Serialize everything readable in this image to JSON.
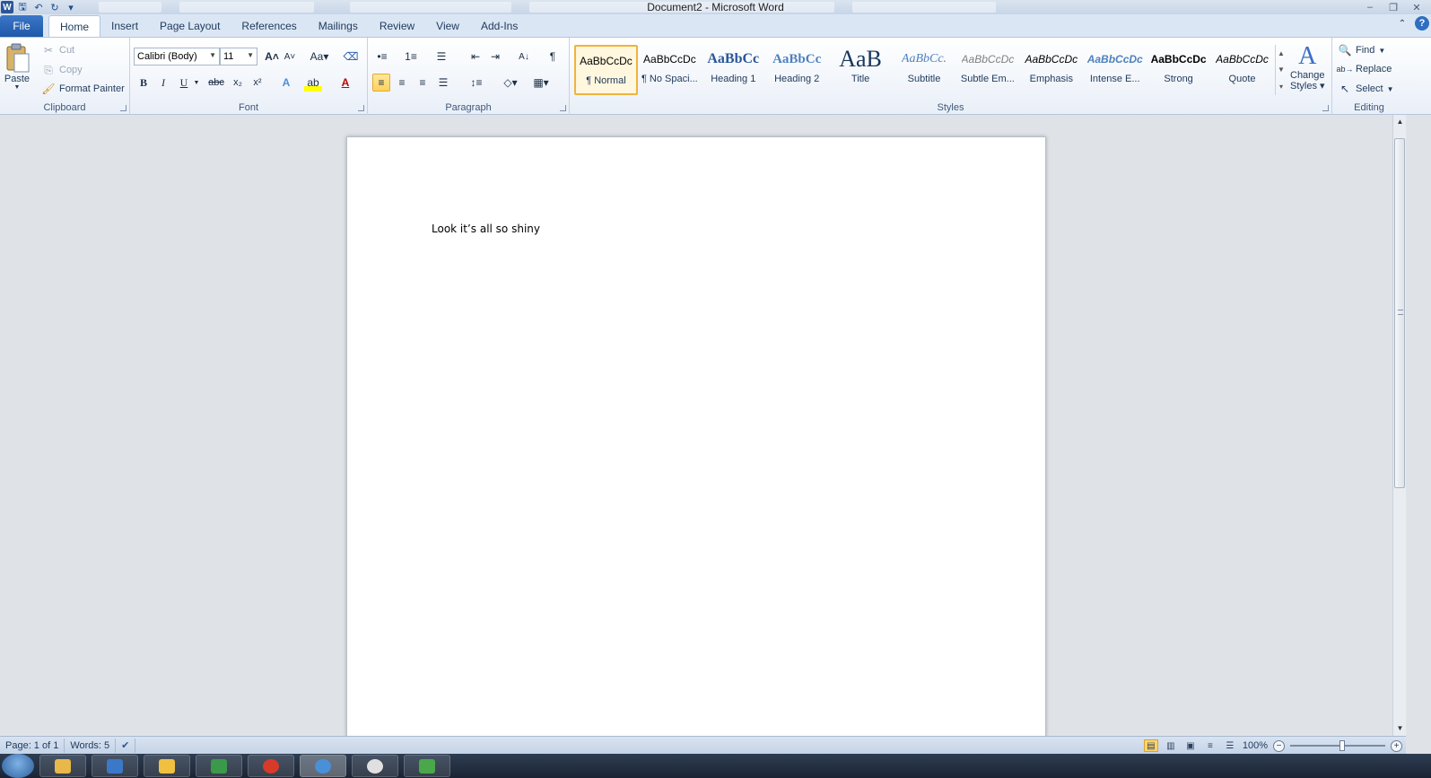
{
  "window": {
    "title": "Document2 - Microsoft Word",
    "qat_icons": [
      "word-logo-icon",
      "save-icon",
      "undo-icon",
      "redo-icon",
      "customize-qat-icon"
    ]
  },
  "tabs": {
    "file": "File",
    "items": [
      "Home",
      "Insert",
      "Page Layout",
      "References",
      "Mailings",
      "Review",
      "View",
      "Add-Ins"
    ],
    "active": "Home"
  },
  "clipboard": {
    "group_label": "Clipboard",
    "paste": "Paste",
    "cut": "Cut",
    "copy": "Copy",
    "format_painter": "Format Painter"
  },
  "font": {
    "group_label": "Font",
    "font_name": "Calibri (Body)",
    "font_size": "11"
  },
  "paragraph": {
    "group_label": "Paragraph"
  },
  "styles": {
    "group_label": "Styles",
    "items": [
      {
        "sample": "AaBbCcDc",
        "name": "¶ Normal"
      },
      {
        "sample": "AaBbCcDc",
        "name": "¶ No Spaci..."
      },
      {
        "sample": "AaBbCc",
        "name": "Heading 1"
      },
      {
        "sample": "AaBbCc",
        "name": "Heading 2"
      },
      {
        "sample": "AaB",
        "name": "Title"
      },
      {
        "sample": "AaBbCc.",
        "name": "Subtitle"
      },
      {
        "sample": "AaBbCcDc",
        "name": "Subtle Em..."
      },
      {
        "sample": "AaBbCcDc",
        "name": "Emphasis"
      },
      {
        "sample": "AaBbCcDc",
        "name": "Intense E..."
      },
      {
        "sample": "AaBbCcDc",
        "name": "Strong"
      },
      {
        "sample": "AaBbCcDc",
        "name": "Quote"
      }
    ],
    "change_styles_line1": "Change",
    "change_styles_line2": "Styles"
  },
  "editing": {
    "group_label": "Editing",
    "find": "Find",
    "replace": "Replace",
    "select": "Select"
  },
  "document": {
    "text": "Look it’s all so shiny"
  },
  "statusbar": {
    "page": "Page: 1 of 1",
    "words": "Words: 5",
    "zoom": "100%"
  },
  "colors": {
    "accent": "#2a5699",
    "file_tab": "#1f58a8",
    "active_style_border": "#f0b33c"
  }
}
